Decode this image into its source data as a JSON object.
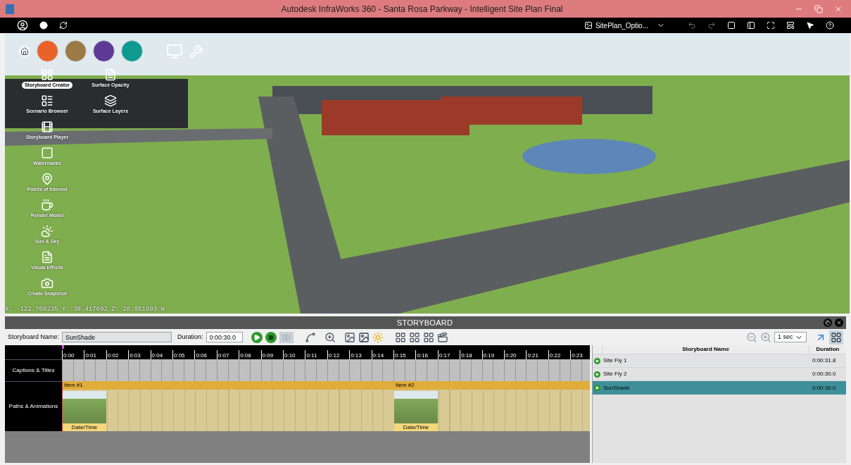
{
  "window": {
    "title": "Autodesk InfraWorks 360 - Santa Rosa Parkway - Intelligent Site Plan Final"
  },
  "toolbar": {
    "proposal": "SitePlan_Optio..."
  },
  "mode_buttons": [
    {
      "color": "#e8622a"
    },
    {
      "color": "#9c7a45"
    },
    {
      "color": "#5c3a96"
    },
    {
      "color": "#0e9a8e"
    }
  ],
  "tools_left": [
    {
      "label": "Storyboard Creator",
      "selected": true
    },
    {
      "label": "Scenario Browser",
      "selected": false
    },
    {
      "label": "Storyboard Player",
      "selected": false
    },
    {
      "label": "Watermarks",
      "selected": false
    },
    {
      "label": "Points of Interest",
      "selected": false
    },
    {
      "label": "Render Model",
      "selected": false
    },
    {
      "label": "Sun & Sky",
      "selected": false
    },
    {
      "label": "Visual Effects",
      "selected": false
    },
    {
      "label": "Create Snapshot",
      "selected": false
    }
  ],
  "tools_right": [
    {
      "label": "Surface Opacity",
      "selected": false
    },
    {
      "label": "Surface Layers",
      "selected": false
    }
  ],
  "coordinates": "X: -122.768235 Y: 38.417692 Z: 28.951993 m",
  "storyboard": {
    "title": "STORYBOARD",
    "name_label": "Storyboard Name:",
    "name": "SunShade",
    "duration_label": "Duration:",
    "duration": "0:00:30.0",
    "interval": "1 sec",
    "ticks": [
      "0:00",
      "0:01",
      "0:02",
      "0:03",
      "0:04",
      "0:05",
      "0:06",
      "0:07",
      "0:08",
      "0:09",
      "0:10",
      "0:11",
      "0:12",
      "0:13",
      "0:14",
      "0:15",
      "0:16",
      "0:17",
      "0:18",
      "0:19",
      "0:20",
      "0:21",
      "0:22",
      "0:23"
    ],
    "tracks": [
      {
        "label": "Captions & Titles",
        "kind": "captions"
      },
      {
        "label": "Paths & Animations",
        "kind": "paths"
      }
    ],
    "items": [
      {
        "title": "Item #1",
        "caption": "Date/Time"
      },
      {
        "title": "Item #2",
        "caption": "Date/Time"
      }
    ],
    "columns": [
      "Storyboard Name",
      "Duration"
    ],
    "rows": [
      {
        "name": "Site Fly 1",
        "duration": "0:00:31.8",
        "selected": false
      },
      {
        "name": "Site Fly 2",
        "duration": "0:00:30.0",
        "selected": false
      },
      {
        "name": "SunShade",
        "duration": "0:00:30.0",
        "selected": true
      }
    ]
  }
}
